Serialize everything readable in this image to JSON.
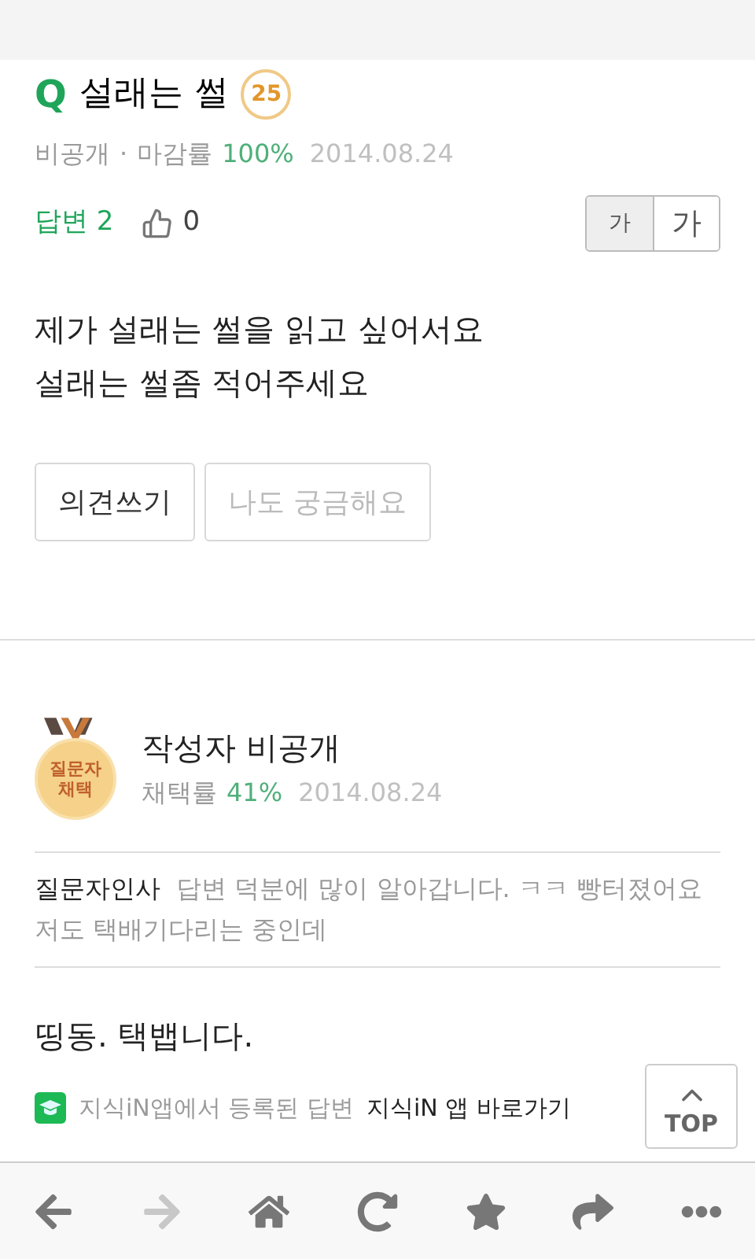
{
  "question": {
    "icon_letter": "Q",
    "title": "설래는 썰",
    "points": "25",
    "visibility": "비공개",
    "separator": "·",
    "close_rate_label": "마감률",
    "close_rate": "100%",
    "date": "2014.08.24"
  },
  "answer_bar": {
    "answers_label": "답변 2",
    "likes": "0",
    "font_sizes": [
      {
        "label": "가",
        "selected": true
      },
      {
        "label": "가",
        "selected": false
      }
    ]
  },
  "body": [
    "제가 설래는 썰을 읽고 싶어서요",
    "설래는 썰좀 적어주세요"
  ],
  "buttons": [
    {
      "label": "의견쓰기",
      "disabled": false
    },
    {
      "label": "나도 궁금해요",
      "disabled": true
    }
  ],
  "answer": {
    "badge": "질문자 채택",
    "author": "작성자 비공개",
    "adopt_label": "채택률",
    "adopt_rate": "41%",
    "date": "2014.08.24",
    "greeting_label": "질문자인사",
    "greeting": "답변 덕분에 많이 알아갑니다. ㅋㅋ 빵터졌어요 저도 택배기다리는 중인데",
    "text": "띵동. 택뱁니다.",
    "app_note": "지식iN앱에서 등록된 답변",
    "app_link": "지식iN 앱 바로가기"
  },
  "top_button": "TOP",
  "nav": [
    {
      "kind": "back",
      "disabled": false
    },
    {
      "kind": "forward",
      "disabled": true
    },
    {
      "kind": "home",
      "disabled": false
    },
    {
      "kind": "reload",
      "disabled": false
    },
    {
      "kind": "bookmark",
      "disabled": false
    },
    {
      "kind": "share",
      "disabled": false
    },
    {
      "kind": "more",
      "disabled": false
    }
  ]
}
